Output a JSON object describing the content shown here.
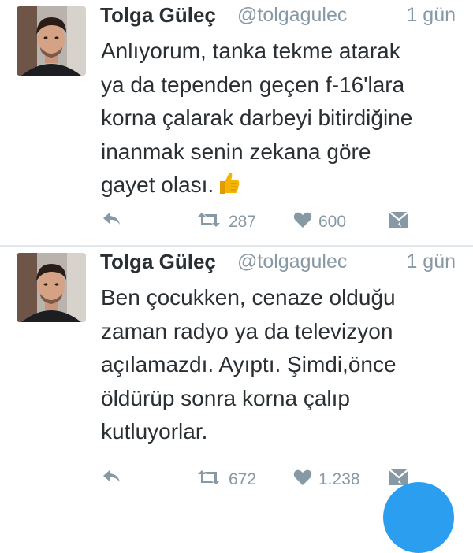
{
  "tweets": [
    {
      "author": {
        "name": "Tolga Güleç",
        "handle": "@tolgagulec"
      },
      "time": "1 gün",
      "text_lines": [
        "Anlıyorum, tanka tekme atarak",
        "ya da tependen geçen f-16'lara",
        "korna çalarak darbeyi bitirdiğine",
        "inanmak senin zekana göre",
        "gayet olası."
      ],
      "emoji": "thumbs-up",
      "retweets": "287",
      "likes": "600"
    },
    {
      "author": {
        "name": "Tolga Güleç",
        "handle": "@tolgagulec"
      },
      "time": "1 gün",
      "text_lines": [
        "Ben çocukken, cenaze olduğu",
        "zaman radyo ya da televizyon",
        "açılamazdı. Ayıptı. Şimdi,önce",
        "öldürüp sonra korna çalıp",
        "kutluyorlar."
      ],
      "retweets": "672",
      "likes": "1.238"
    }
  ],
  "colors": {
    "text": "#292f33",
    "secondary": "#8899a6",
    "divider": "#e1e8ed",
    "accent": "#2b9ef0",
    "emoji": "#f4b400"
  },
  "icons": {
    "reply": "reply-icon",
    "retweet": "retweet-icon",
    "like": "heart-icon",
    "dm": "direct-message-icon",
    "compose": "compose-fab"
  }
}
